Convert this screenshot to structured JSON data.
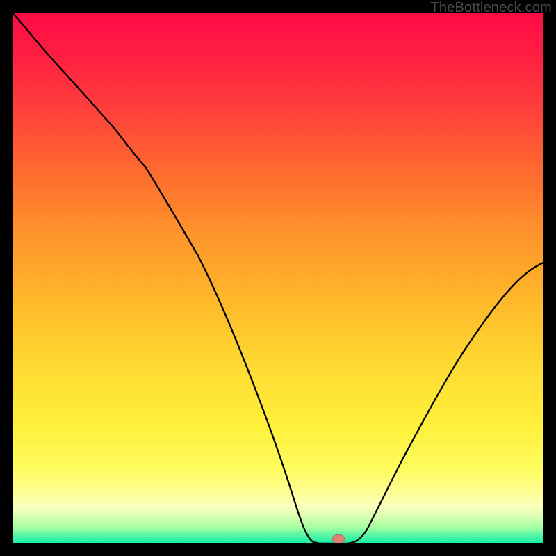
{
  "watermark": "TheBottleneck.com",
  "colors": {
    "frame": "#000000",
    "curve": "#000000",
    "marker": "#db8275"
  },
  "chart_data": {
    "type": "line",
    "title": "",
    "xlabel": "",
    "ylabel": "",
    "xlim": [
      0,
      100
    ],
    "ylim": [
      0,
      100
    ],
    "grid": false,
    "series": [
      {
        "name": "bottleneck-curve",
        "x": [
          0,
          5,
          10,
          15,
          20,
          25,
          30,
          35,
          40,
          45,
          50,
          53,
          55,
          58,
          60,
          63,
          66,
          70,
          75,
          80,
          85,
          90,
          95,
          100
        ],
        "values": [
          100,
          93,
          86,
          79,
          72,
          64,
          57,
          48,
          39,
          29,
          18,
          10,
          3,
          0,
          0,
          0,
          2,
          8,
          17,
          26,
          34,
          41,
          47,
          52
        ]
      }
    ],
    "marker": {
      "x": 61.5,
      "y": 0
    },
    "legend": false
  }
}
